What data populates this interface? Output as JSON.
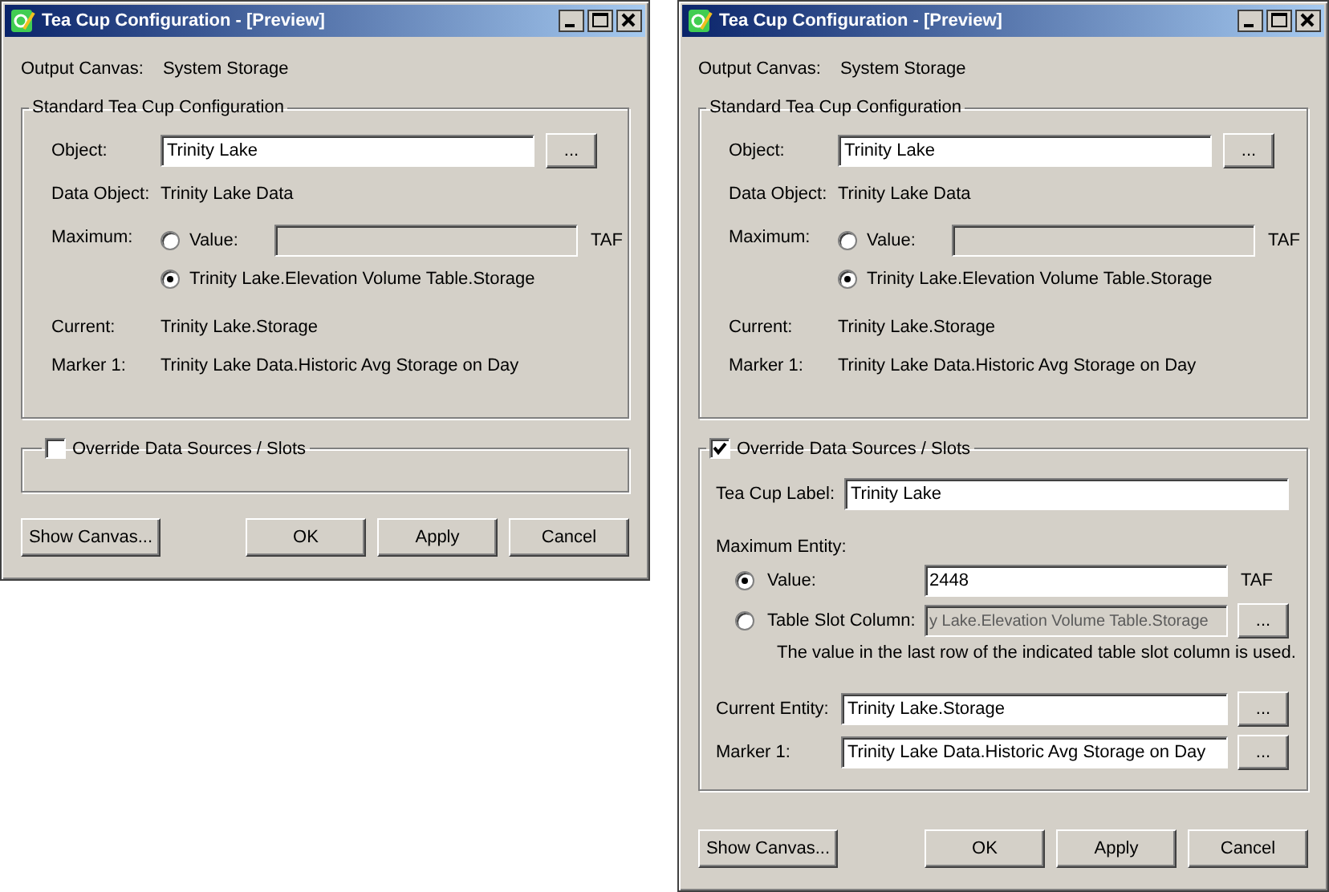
{
  "dialogs": [
    {
      "title": "Tea Cup Configuration - [Preview]",
      "output_canvas": {
        "label": "Output Canvas:",
        "value": "System Storage"
      },
      "standard": {
        "title": "Standard Tea Cup Configuration",
        "object": {
          "label": "Object:",
          "value": "Trinity Lake",
          "browse": "..."
        },
        "data_object": {
          "label": "Data Object:",
          "value": "Trinity Lake Data"
        },
        "maximum": {
          "label": "Maximum:",
          "options": [
            {
              "kind": "value",
              "label": "Value:",
              "unit": "TAF",
              "selected": false
            },
            {
              "kind": "slot",
              "label": "Trinity Lake.Elevation Volume Table.Storage",
              "selected": true
            }
          ]
        },
        "current": {
          "label": "Current:",
          "value": "Trinity Lake.Storage"
        },
        "marker": {
          "label": "Marker 1:",
          "value": "Trinity Lake Data.Historic Avg Storage on Day"
        }
      },
      "override": {
        "label": "Override Data Sources / Slots",
        "checked": false
      },
      "buttons": [
        "Show Canvas...",
        "OK",
        "Apply",
        "Cancel"
      ]
    },
    {
      "title": "Tea Cup Configuration - [Preview]",
      "output_canvas": {
        "label": "Output Canvas:",
        "value": "System Storage"
      },
      "standard": {
        "title": "Standard Tea Cup Configuration",
        "object": {
          "label": "Object:",
          "value": "Trinity Lake",
          "browse": "..."
        },
        "data_object": {
          "label": "Data Object:",
          "value": "Trinity Lake Data"
        },
        "maximum": {
          "label": "Maximum:",
          "options": [
            {
              "kind": "value",
              "label": "Value:",
              "unit": "TAF",
              "selected": false
            },
            {
              "kind": "slot",
              "label": "Trinity Lake.Elevation Volume Table.Storage",
              "selected": true
            }
          ]
        },
        "current": {
          "label": "Current:",
          "value": "Trinity Lake.Storage"
        },
        "marker": {
          "label": "Marker 1:",
          "value": "Trinity Lake Data.Historic Avg Storage on Day"
        }
      },
      "override": {
        "label": "Override Data Sources / Slots",
        "checked": true,
        "tea_cup_label": {
          "label": "Tea Cup Label:",
          "value": "Trinity Lake"
        },
        "maximum_entity": {
          "label": "Maximum Entity:",
          "options": [
            {
              "kind": "value",
              "label": "Value:",
              "value": "2448",
              "unit": "TAF",
              "selected": true
            },
            {
              "kind": "slot",
              "label": "Table Slot Column:",
              "value": "y Lake.Elevation Volume Table.Storage",
              "browse": "...",
              "disabled": true,
              "selected": false
            }
          ],
          "note": "The value in the last row of the indicated table slot column is used."
        },
        "current_entity": {
          "label": "Current Entity:",
          "value": "Trinity Lake.Storage",
          "browse": "..."
        },
        "marker": {
          "label": "Marker 1:",
          "value": "Trinity Lake Data.Historic Avg Storage on Day",
          "browse": "..."
        }
      },
      "buttons": [
        "Show Canvas...",
        "OK",
        "Apply",
        "Cancel"
      ]
    }
  ]
}
